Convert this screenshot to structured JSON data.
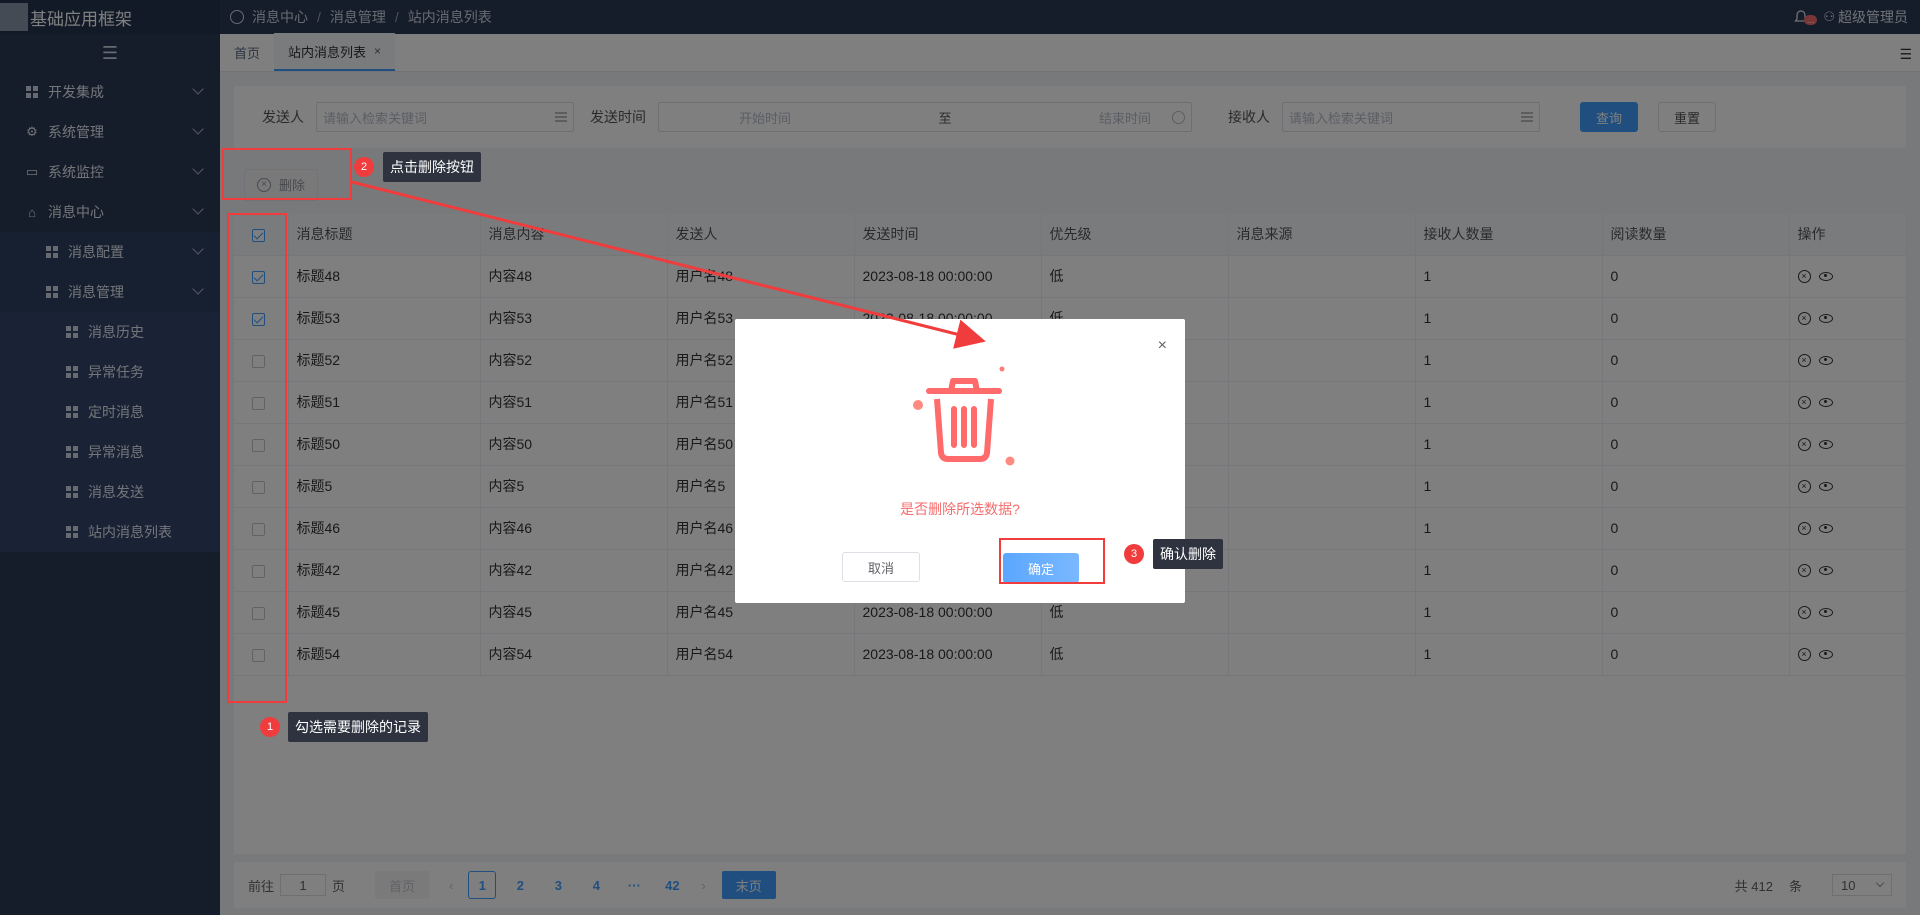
{
  "app": {
    "title": "基础应用框架"
  },
  "sidebar": {
    "items": [
      {
        "label": "开发集成"
      },
      {
        "label": "系统管理"
      },
      {
        "label": "系统监控"
      },
      {
        "label": "消息中心"
      }
    ],
    "sub": [
      {
        "label": "消息配置"
      },
      {
        "label": "消息管理"
      }
    ],
    "sub3": [
      {
        "label": "消息历史"
      },
      {
        "label": "异常任务"
      },
      {
        "label": "定时消息"
      },
      {
        "label": "异常消息"
      },
      {
        "label": "消息发送"
      },
      {
        "label": "站内消息列表"
      }
    ]
  },
  "header": {
    "breadcrumb": [
      "消息中心",
      "消息管理",
      "站内消息列表"
    ],
    "notification_badge": "...",
    "user": "超级管理员"
  },
  "tabs": [
    {
      "label": "首页"
    },
    {
      "label": "站内消息列表",
      "close": "×"
    }
  ],
  "filter": {
    "sender_label": "发送人",
    "sender_placeholder": "请输入检索关键词",
    "time_label": "发送时间",
    "start_placeholder": "开始时间",
    "to": "至",
    "end_placeholder": "结束时间",
    "receiver_label": "接收人",
    "receiver_placeholder": "请输入检索关键词",
    "query": "查询",
    "reset": "重置"
  },
  "toolbar": {
    "delete": "删除"
  },
  "table": {
    "columns": [
      "消息标题",
      "消息内容",
      "发送人",
      "发送时间",
      "优先级",
      "消息来源",
      "接收人数量",
      "阅读数量",
      "操作"
    ],
    "rows": [
      {
        "checked": true,
        "title": "标题48",
        "content": "内容48",
        "sender": "用户名48",
        "time": "2023-08-18 00:00:00",
        "priority": "低",
        "source": "",
        "receivers": "1",
        "reads": "0"
      },
      {
        "checked": true,
        "title": "标题53",
        "content": "内容53",
        "sender": "用户名53",
        "time": "2023-08-18 00:00:00",
        "priority": "低",
        "source": "",
        "receivers": "1",
        "reads": "0"
      },
      {
        "checked": false,
        "title": "标题52",
        "content": "内容52",
        "sender": "用户名52",
        "time": "",
        "priority": "",
        "source": "",
        "receivers": "1",
        "reads": "0"
      },
      {
        "checked": false,
        "title": "标题51",
        "content": "内容51",
        "sender": "用户名51",
        "time": "",
        "priority": "",
        "source": "",
        "receivers": "1",
        "reads": "0"
      },
      {
        "checked": false,
        "title": "标题50",
        "content": "内容50",
        "sender": "用户名50",
        "time": "",
        "priority": "",
        "source": "",
        "receivers": "1",
        "reads": "0"
      },
      {
        "checked": false,
        "title": "标题5",
        "content": "内容5",
        "sender": "用户名5",
        "time": "",
        "priority": "",
        "source": "",
        "receivers": "1",
        "reads": "0"
      },
      {
        "checked": false,
        "title": "标题46",
        "content": "内容46",
        "sender": "用户名46",
        "time": "",
        "priority": "",
        "source": "",
        "receivers": "1",
        "reads": "0"
      },
      {
        "checked": false,
        "title": "标题42",
        "content": "内容42",
        "sender": "用户名42",
        "time": "",
        "priority": "",
        "source": "",
        "receivers": "1",
        "reads": "0"
      },
      {
        "checked": false,
        "title": "标题45",
        "content": "内容45",
        "sender": "用户名45",
        "time": "2023-08-18 00:00:00",
        "priority": "低",
        "source": "",
        "receivers": "1",
        "reads": "0"
      },
      {
        "checked": false,
        "title": "标题54",
        "content": "内容54",
        "sender": "用户名54",
        "time": "2023-08-18 00:00:00",
        "priority": "低",
        "source": "",
        "receivers": "1",
        "reads": "0"
      }
    ]
  },
  "pagination": {
    "goto": "前往",
    "page_value": "1",
    "page_unit": "页",
    "first": "首页",
    "pages": [
      "1",
      "2",
      "3",
      "4",
      "···",
      "42"
    ],
    "last": "末页",
    "total": "共 412",
    "total_unit": "条",
    "page_size": "10"
  },
  "dialog": {
    "message": "是否删除所选数据?",
    "cancel": "取消",
    "confirm": "确定",
    "close": "×"
  },
  "annotations": [
    {
      "num": "1",
      "text": "勾选需要删除的记录"
    },
    {
      "num": "2",
      "text": "点击删除按钮"
    },
    {
      "num": "3",
      "text": "确认删除"
    }
  ],
  "colors": {
    "accent": "#409eff",
    "danger": "#f56c6c",
    "annotation": "#f03c3c",
    "sidebar": "#2b3b55"
  }
}
